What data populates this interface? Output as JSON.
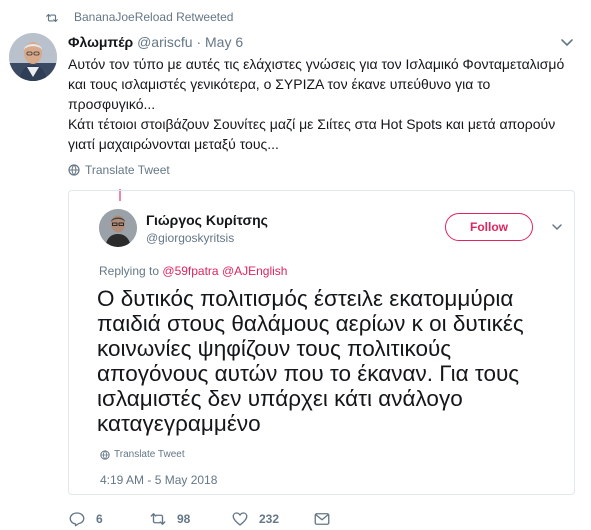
{
  "retweet_banner": {
    "text": "BananaJoeReload Retweeted"
  },
  "tweet": {
    "author_name": "Φλωμπέρ",
    "handle": "@ariscfu",
    "separator": "·",
    "date": "May 6",
    "lines": [
      "Αυτόν τον τύπο με αυτές τις ελάχιστες γνώσεις για τον Ισλαμικό Φονταμεταλισμό",
      "και τους ισλαμιστές γενικότερα, ο ΣΥΡΙΖΑ τον έκανε υπεύθυνο για το",
      "προσφυγικό...",
      "Κάτι τέτοιοι στοιβάζουν Σουνίτες μαζί με Σιίτες στα Hot Spots και μετά απορούν",
      "γιατί μαχαιρώνονται μεταξύ τους..."
    ],
    "translate_label": "Translate Tweet"
  },
  "quoted": {
    "author_name": "Γιώργος Κυρίτσης",
    "handle": "@giorgoskyritsis",
    "follow_label": "Follow",
    "replying_prefix": "Replying to",
    "replying_mentions": "@59fpatra @AJEnglish",
    "lines": [
      "Ο δυτικός πολιτισμός έστειλε εκατομμύρια",
      "παιδιά στους θαλάμους αερίων κ οι δυτικές",
      "κοινωνίες ψηφίζουν τους πολιτικούς",
      "απογόνους αυτών που το έκαναν. Για τους",
      "ισλαμιστές δεν υπάρχει κάτι ανάλογο",
      "καταγεγραμμένο"
    ],
    "translate_label": "Translate Tweet",
    "timestamp": "4:19 AM - 5 May 2018"
  },
  "actions": {
    "reply_count": "6",
    "retweet_count": "98",
    "like_count": "232"
  },
  "colors": {
    "accent": "#e0245e",
    "muted": "#657786",
    "text": "#14171a",
    "border": "#e1e8ed"
  }
}
